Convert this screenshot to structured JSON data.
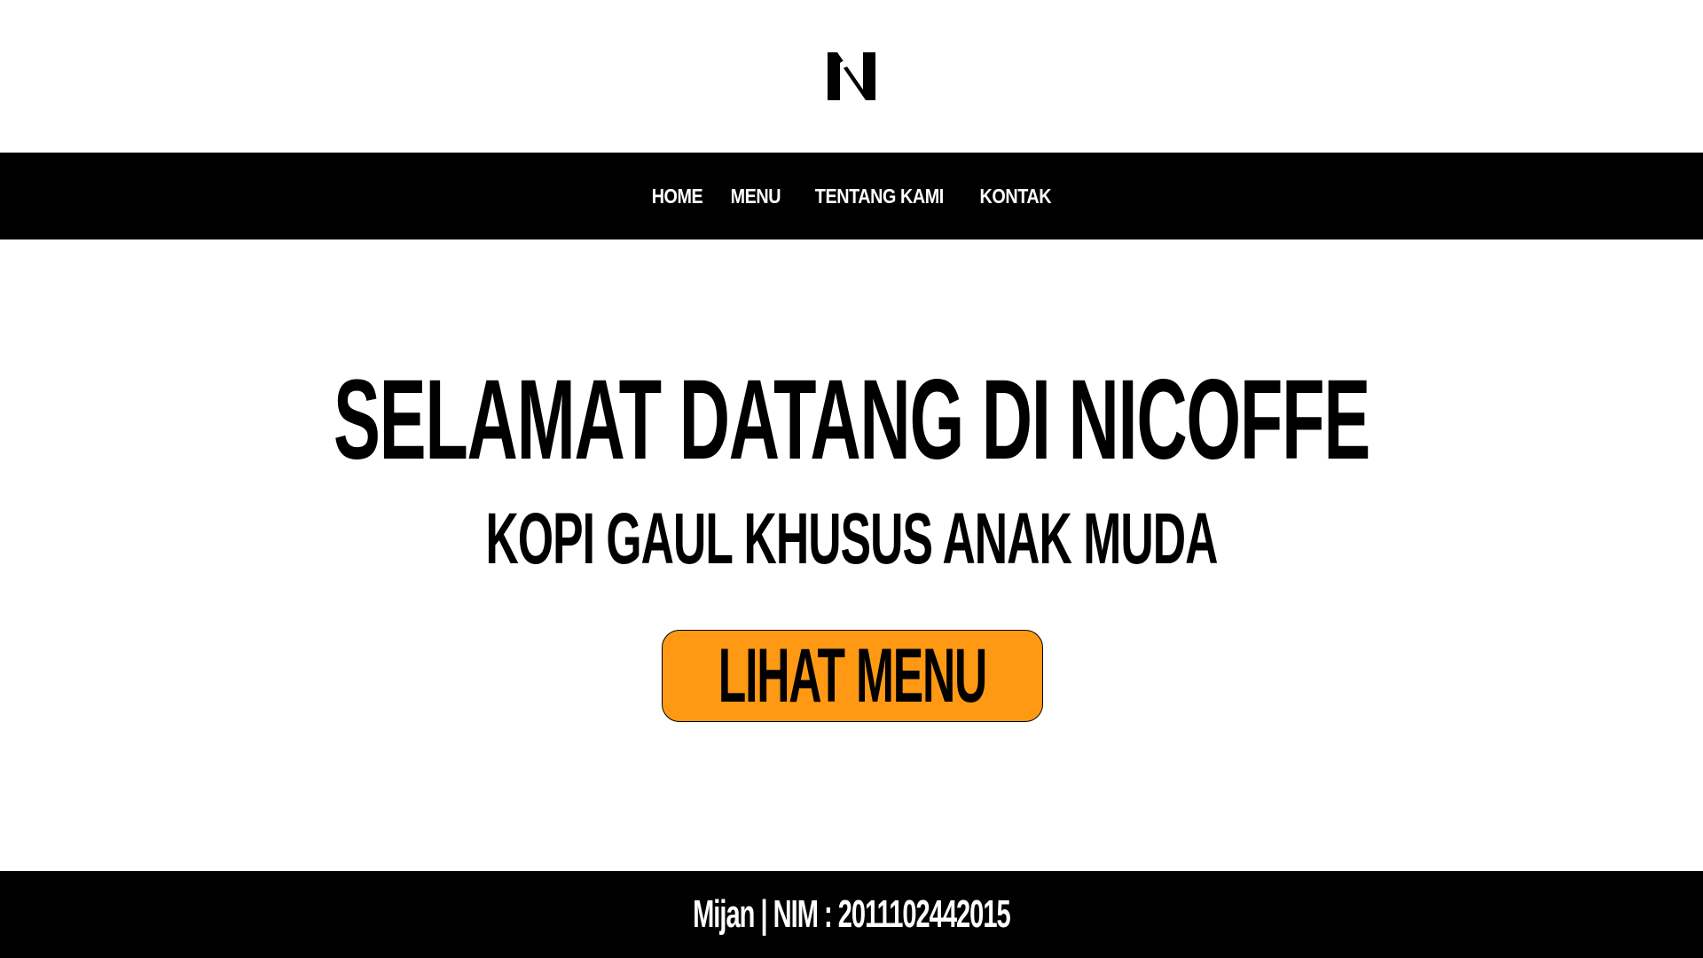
{
  "brand": {
    "logo_icon": "nicoffe-n-logo-icon",
    "logo_letter": "N"
  },
  "nav": {
    "items": [
      {
        "label": "HOME"
      },
      {
        "label": "MENU"
      },
      {
        "label": "TENTANG KAMI"
      },
      {
        "label": "KONTAK"
      }
    ]
  },
  "hero": {
    "title": "SELAMAT DATANG DI NICOFFE",
    "subtitle": "KOPI GAUL KHUSUS ANAK MUDA",
    "cta_label": "LIHAT MENU"
  },
  "footer": {
    "text": "Mijan | NIM : 2011102442015"
  },
  "colors": {
    "background": "#ffffff",
    "bars": "#000000",
    "accent": "#ff9914",
    "text_on_dark": "#ffffff",
    "text_on_light": "#000000"
  }
}
